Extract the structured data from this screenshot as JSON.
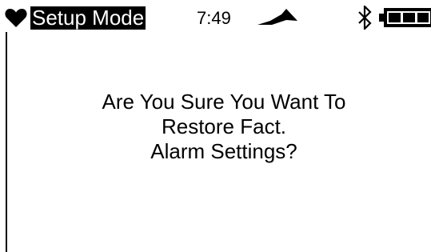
{
  "status_bar": {
    "mode": "Setup Mode",
    "time": "7:49",
    "icons": {
      "heart": "heart-icon",
      "signal": "signal-icon",
      "bluetooth": "bluetooth-icon",
      "battery": "battery-icon"
    }
  },
  "dialog": {
    "lines": [
      "Are You Sure You Want To",
      "Restore Fact.",
      "Alarm Settings?"
    ]
  },
  "colors": {
    "foreground": "#000000",
    "background": "#ffffff"
  }
}
